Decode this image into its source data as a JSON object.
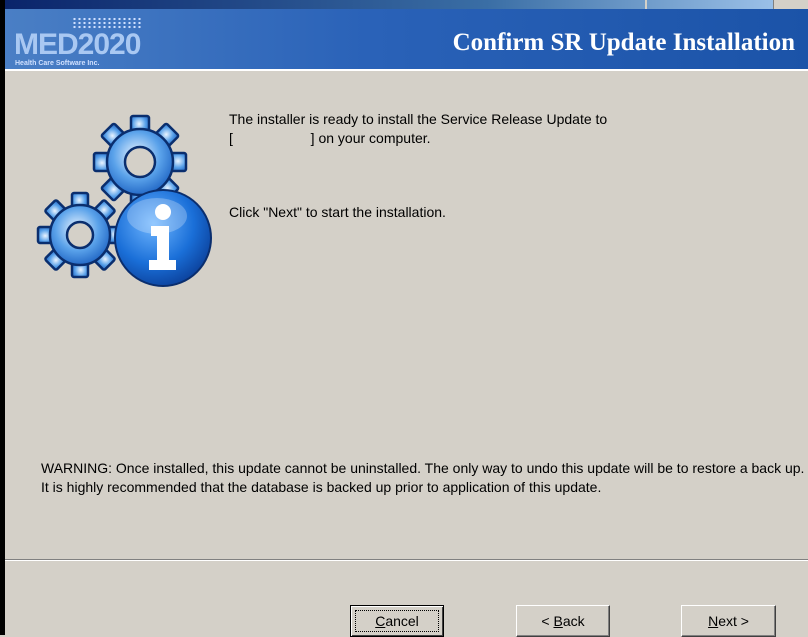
{
  "window": {
    "logo": {
      "text": "MED2020",
      "tagline": "Health Care Software Inc."
    },
    "title": "Confirm SR Update Installation"
  },
  "body": {
    "intro_lines": [
      "The installer is ready to install the Service Release Update to",
      "[                    ] on your computer."
    ],
    "instruction": "Click \"Next\" to start the installation.",
    "warning": "WARNING: Once installed, this update cannot be uninstalled.  The only way to undo this update will be to restore a back up.  It is highly recommended that the database is backed up prior to application of this update."
  },
  "buttons": {
    "cancel": {
      "pre": "",
      "key": "C",
      "post": "ancel"
    },
    "back": {
      "pre": "< ",
      "key": "B",
      "post": "ack"
    },
    "next": {
      "pre": "",
      "key": "N",
      "post": "ext >"
    }
  },
  "icons": {
    "main_icon": "gears-with-info-icon"
  },
  "colors": {
    "header_blue": "#2a62b8",
    "dialog_gray": "#d4d0c8",
    "icon_blue": "#1a6fd8"
  }
}
